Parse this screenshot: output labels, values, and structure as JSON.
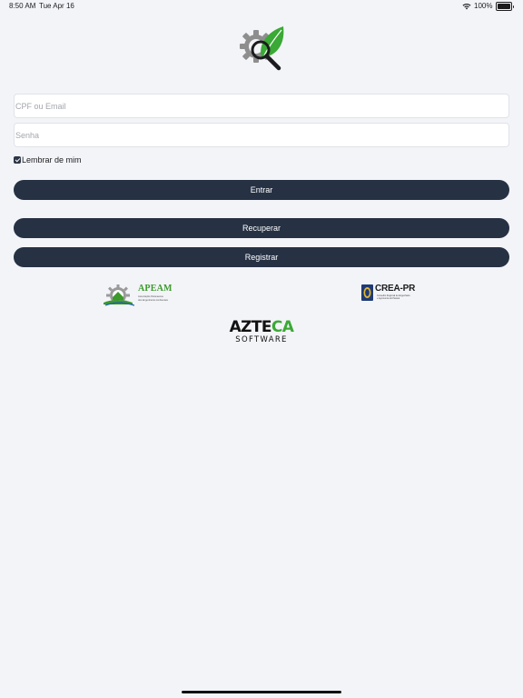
{
  "status_bar": {
    "time": "8:50 AM",
    "date": "Tue Apr 16",
    "battery": "100%",
    "icons": [
      "wifi-icon",
      "battery-icon"
    ]
  },
  "app_logo": {
    "icon": "gear-magnifier-leaf-icon",
    "colors": {
      "gear": "#8e8e8e",
      "leaf": "#3aa935",
      "lens": "#1c1c1e"
    }
  },
  "login_form": {
    "username_placeholder": "CPF ou Email",
    "username_value": "",
    "password_placeholder": "Senha",
    "password_value": "",
    "remember_label": "Lembrar de mim",
    "remember_checked": true
  },
  "buttons": {
    "entrar": "Entrar",
    "recuperar": "Recuperar",
    "registrar": "Registrar"
  },
  "partners": {
    "apeam": {
      "name": "APEAM",
      "subtitle_line1": "Associação Paranaense",
      "subtitle_line2": "dos Engenheiros Ambientais"
    },
    "crea": {
      "name": "CREA-PR",
      "subtitle_line1": "Conselho Regional de Engenharia",
      "subtitle_line2": "e Agronomia do Paraná"
    },
    "azteca": {
      "name_part1": "AZTE",
      "name_part2": "CA",
      "subtitle": "SOFTWARE"
    }
  },
  "colors": {
    "background": "#f3f4f8",
    "button": "#263144",
    "button_text": "#ffffff",
    "brand_green": "#3aa935"
  }
}
